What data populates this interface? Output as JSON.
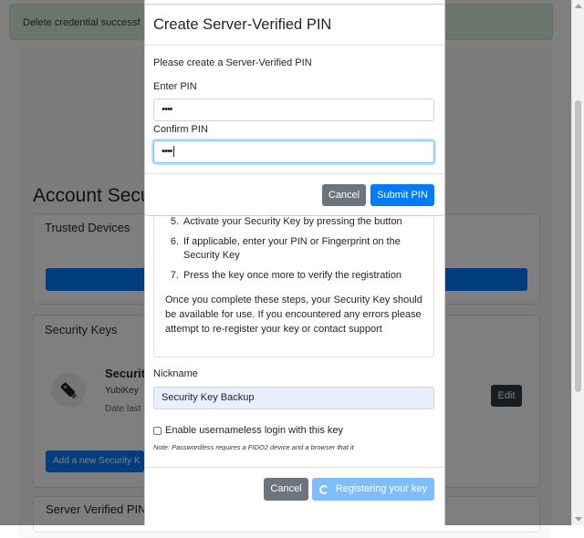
{
  "background": {
    "alert_text": "Delete credential successf",
    "page_title": "Account Secu",
    "trusted_devices_header": "Trusted Devices",
    "security_keys_header": "Security Keys",
    "key_name": "Securit",
    "key_model": "YubiKey",
    "key_date": "Date last",
    "edit_button": "Edit",
    "add_key_button": "Add a new Security K",
    "server_pin_header": "Server Verified PIN"
  },
  "registration_modal": {
    "steps": [
      {
        "num": "5.",
        "text": "Activate your Security Key by pressing the button"
      },
      {
        "num": "6.",
        "text": "If applicable, enter your PIN or Fingerprint on the Security Key"
      },
      {
        "num": "7.",
        "text": "Press the key once more to verify the registration"
      }
    ],
    "after_text": "Once you complete these steps, your Security Key should be available for use. If you encountered any errors please attempt to re-register your key or contact support",
    "nickname_label": "Nickname",
    "nickname_value": "Security Key Backup",
    "passwordless_label": "Enable usernameless login with this key",
    "passwordless_note": "Note: Passwordless requires a FIDO2 device and a browser that it",
    "cancel_label": "Cancel",
    "registering_label": "Registering your key"
  },
  "pin_modal": {
    "title": "Create Server-Verified PIN",
    "prompt": "Please create a Server-Verified PIN",
    "enter_label": "Enter PIN",
    "enter_value": "••••",
    "confirm_label": "Confirm PIN",
    "confirm_value": "••••",
    "cancel_label": "Cancel",
    "submit_label": "Submit PIN"
  },
  "colors": {
    "primary": "#007bff",
    "secondary": "#6c757d",
    "success_bg": "#d4edda"
  }
}
